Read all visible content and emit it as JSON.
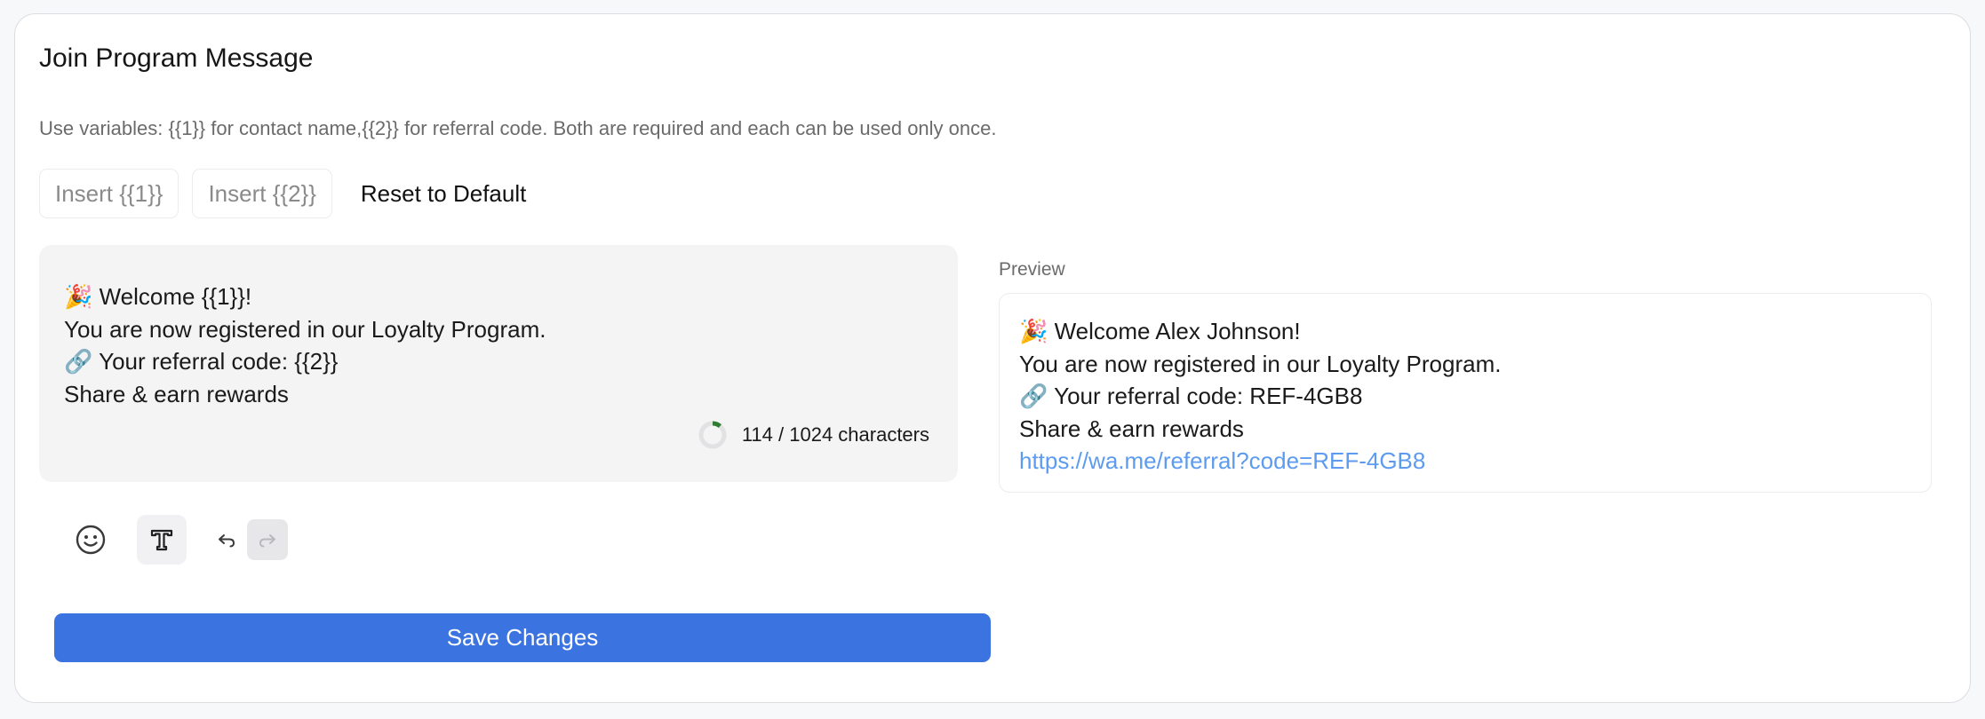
{
  "card": {
    "title": "Join Program Message",
    "hint": "Use variables: {{1}} for contact name,{{2}} for referral code. Both are required and each can be used only once."
  },
  "actions": {
    "insert_1": "Insert {{1}}",
    "insert_2": "Insert {{2}}",
    "reset": "Reset to Default"
  },
  "editor": {
    "lines": [
      {
        "emoji": "🎉",
        "text": " Welcome {{1}}!"
      },
      {
        "emoji": "",
        "text": "You are now registered in our Loyalty Program."
      },
      {
        "emoji": "🔗",
        "text": " Your referral code: {{2}}"
      },
      {
        "emoji": "",
        "text": "Share & earn rewards"
      }
    ],
    "char_count": "114 / 1024 characters",
    "usage_fraction": 0.111
  },
  "preview": {
    "label": "Preview",
    "lines": [
      {
        "emoji": "🎉",
        "text": " Welcome Alex Johnson!"
      },
      {
        "emoji": "",
        "text": "You are now registered in our Loyalty Program."
      },
      {
        "emoji": "🔗",
        "text": " Your referral code: REF-4GB8"
      },
      {
        "emoji": "",
        "text": "Share & earn rewards"
      }
    ],
    "link": "https://wa.me/referral?code=REF-4GB8"
  },
  "toolbar": {
    "icons": [
      "emoji-icon",
      "text-format-icon",
      "undo-icon",
      "redo-icon"
    ]
  },
  "save_label": "Save Changes",
  "colors": {
    "accent": "#3b73e0",
    "link": "#5c9bf0",
    "progress": "#2e7d32"
  }
}
